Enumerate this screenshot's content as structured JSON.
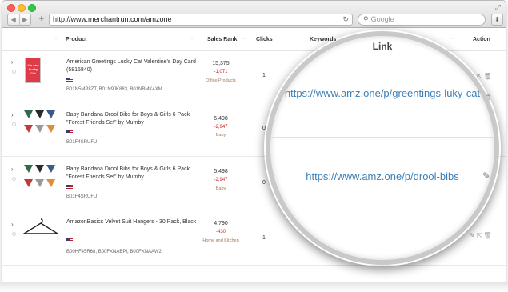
{
  "browser": {
    "url": "http://www.merchantrun.com/amzone",
    "search_placeholder": "Google",
    "back_glyph": "◀",
    "forward_glyph": "▶",
    "plus_glyph": "+",
    "reload_glyph": "↻",
    "search_glyph": "⚲",
    "download_glyph": "⬇",
    "expand_glyph": "⤢"
  },
  "table": {
    "sort_glyph": "⌃",
    "columns": {
      "product": "Product",
      "sales_rank": "Sales Rank",
      "clicks": "Clicks",
      "keywords": "Keywords",
      "action": "Action"
    },
    "expand_glyph": "›",
    "action_glyphs": "✎⇱🗑",
    "rows": [
      {
        "title": "American Greetings Lucky Cat Valentine's Day Card (5815840)",
        "asins": "B01N5MP8ZT, B01N9JK883, B01NBMK4XM",
        "rank": "15,375",
        "rank_delta": "-1,071",
        "category": "Office Products",
        "clicks": "1",
        "thumb_text": "I'm one Lucky Cat"
      },
      {
        "title": "Baby Bandana Drool Bibs for Boys & Girls 6 Pack \"Forest Friends Set\" by Mumby",
        "asins": "B01F4SRUFU",
        "rank": "5,498",
        "rank_delta": "-2,947",
        "category": "Baby",
        "clicks": "0"
      },
      {
        "title": "Baby Bandana Drool Bibs for Boys & Girls 6 Pack \"Forest Friends Set\" by Mumby",
        "asins": "B01F4SRUFU",
        "rank": "5,498",
        "rank_delta": "-2,947",
        "category": "Baby",
        "clicks": "0"
      },
      {
        "title": "AmazonBasics Velvet Suit Hangers - 30 Pack, Black",
        "asins": "B00HF45R68, B00FXNABPI, B00FXNAAW2",
        "rank": "4,790",
        "rank_delta": "-430",
        "category": "Home and Kitchen",
        "clicks": "1"
      }
    ]
  },
  "magnifier": {
    "title": "Link",
    "link1": "https://www.amz.one/p/greentings-luky-cat",
    "link2": "https://www.amz.one/p/drool-bibs",
    "edge_glyph": "✎"
  },
  "colors": {
    "link": "#3d7fb8",
    "rank_delta": "#d21f1f",
    "category": "#a07a57"
  }
}
